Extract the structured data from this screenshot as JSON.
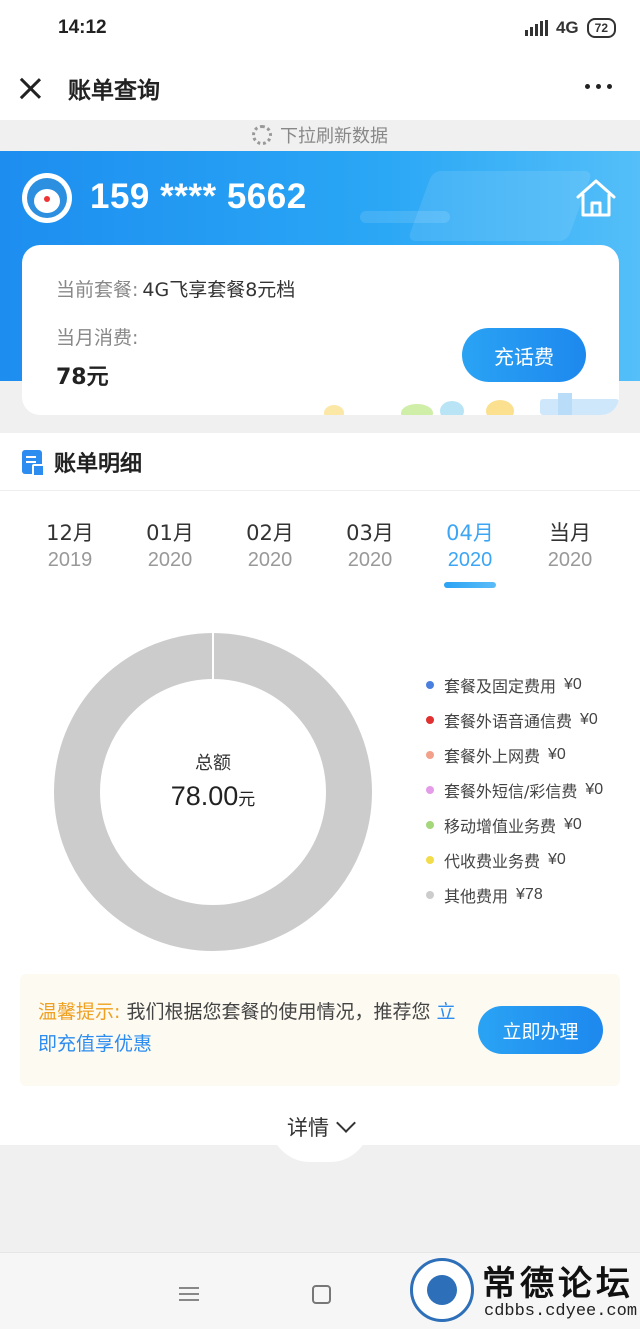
{
  "status_bar": {
    "time": "14:12",
    "network": "4G",
    "battery": "72"
  },
  "title_bar": {
    "title": "账单查询"
  },
  "refresh": {
    "text": "下拉刷新数据"
  },
  "account": {
    "phone": "159 **** 5662",
    "plan_label": "当前套餐:",
    "plan_value": "4G飞享套餐8元档",
    "spend_label": "当月消费:",
    "spend_value": "78元",
    "recharge_button": "充话费"
  },
  "bill": {
    "section_title": "账单明细",
    "months": [
      {
        "month": "12月",
        "year": "2019",
        "active": false
      },
      {
        "month": "01月",
        "year": "2020",
        "active": false
      },
      {
        "month": "02月",
        "year": "2020",
        "active": false
      },
      {
        "month": "03月",
        "year": "2020",
        "active": false
      },
      {
        "month": "04月",
        "year": "2020",
        "active": true
      },
      {
        "month": "当月",
        "year": "2020",
        "active": false
      }
    ],
    "total_label": "总额",
    "total_value": "78.00",
    "total_unit": "元",
    "legend": [
      {
        "name": "套餐及固定费用",
        "value": "¥0",
        "color": "#4a7fe0"
      },
      {
        "name": "套餐外语音通信费",
        "value": "¥0",
        "color": "#e03030"
      },
      {
        "name": "套餐外上网费",
        "value": "¥0",
        "color": "#f2a08a"
      },
      {
        "name": "套餐外短信/彩信费",
        "value": "¥0",
        "color": "#e49be8"
      },
      {
        "name": "移动增值业务费",
        "value": "¥0",
        "color": "#a4d67a"
      },
      {
        "name": "代收费业务费",
        "value": "¥0",
        "color": "#f3dc4a"
      },
      {
        "name": "其他费用",
        "value": "¥78",
        "color": "#cccccc"
      }
    ]
  },
  "chart_data": {
    "type": "pie",
    "categories": [
      "套餐及固定费用",
      "套餐外语音通信费",
      "套餐外上网费",
      "套餐外短信/彩信费",
      "移动增值业务费",
      "代收费业务费",
      "其他费用"
    ],
    "values": [
      0,
      0,
      0,
      0,
      0,
      0,
      78
    ],
    "colors": [
      "#4a7fe0",
      "#e03030",
      "#f2a08a",
      "#e49be8",
      "#a4d67a",
      "#f3dc4a",
      "#cccccc"
    ]
  },
  "tip": {
    "label": "温馨提示:",
    "text": "我们根据您套餐的使用情况，推荐您",
    "link": "立即充值享优惠",
    "button": "立即办理"
  },
  "details": {
    "label": "详情"
  },
  "watermark": {
    "title": "常德论坛",
    "url": "cdbbs.cdyee.com"
  }
}
